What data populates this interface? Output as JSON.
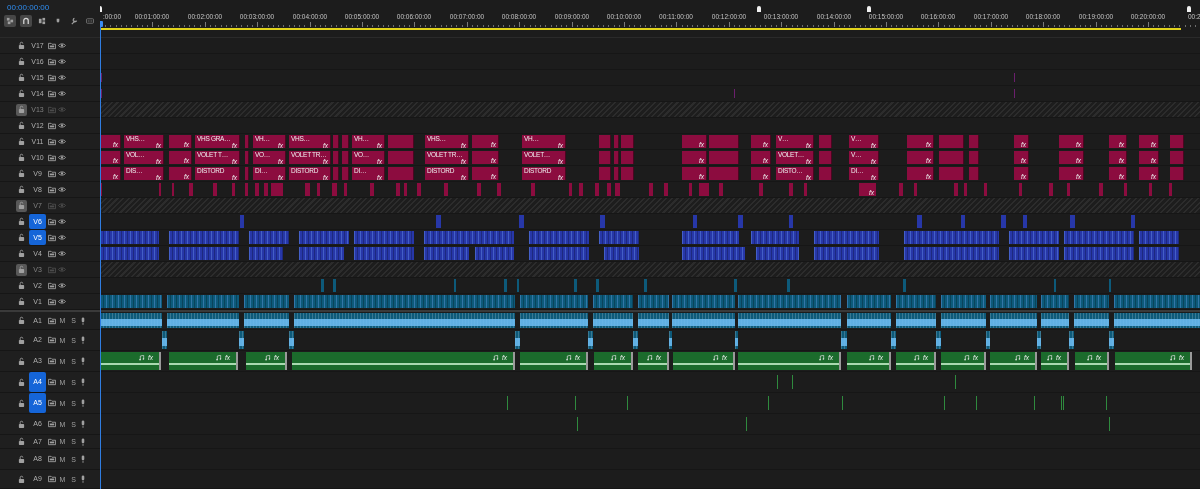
{
  "timecode": "00:00:00:00",
  "toolbar": [
    {
      "kind": "nest",
      "selected": true
    },
    {
      "kind": "snap",
      "selected": true
    },
    {
      "kind": "linked",
      "selected": false
    },
    {
      "kind": "marker",
      "selected": false
    },
    {
      "kind": "wrench",
      "selected": false
    },
    {
      "kind": "captions",
      "selected": false
    }
  ],
  "ruler": {
    "labels": [
      ":00:00",
      "00:01:00:00",
      "00:02:00:00",
      "00:03:00:00",
      "00:04:00:00",
      "00:05:00:00",
      "00:06:00:00",
      "00:07:00:00",
      "00:08:00:00",
      "00:09:00:00",
      "00:10:00:00",
      "00:11:00:00",
      "00:12:00:00",
      "00:13:00:00",
      "00:14:00:00",
      "00:15:00:00",
      "00:16:00:00",
      "00:17:00:00",
      "00:18:00:00",
      "00:19:00:00",
      "00:20:00:00",
      "00:2"
    ]
  },
  "tracks": [
    {
      "name": "V17",
      "kind": "video",
      "locked": false,
      "targeted": false
    },
    {
      "name": "V16",
      "kind": "video",
      "locked": false,
      "targeted": false
    },
    {
      "name": "V15",
      "kind": "video",
      "locked": false,
      "targeted": false,
      "color": "#6b1f6d"
    },
    {
      "name": "V14",
      "kind": "video",
      "locked": false,
      "targeted": false,
      "color": "#6b1f6d"
    },
    {
      "name": "V13",
      "kind": "video",
      "locked": true,
      "targeted": false
    },
    {
      "name": "V12",
      "kind": "video",
      "locked": false,
      "targeted": false
    },
    {
      "name": "V11",
      "kind": "video",
      "locked": false,
      "targeted": false,
      "color": "#8c0c3f",
      "clips": [
        {
          "fx": "fx"
        },
        {
          "label": "VHS…",
          "fx": "fx"
        },
        {
          "fx": "fx"
        },
        {
          "label": "VHS GRA…",
          "fx": "fx"
        },
        {
          "label": "VH…",
          "fx": "fx"
        },
        {
          "label": "VHS…",
          "fx": "fx"
        },
        {
          "label": "VH…",
          "fx": "fx"
        },
        {
          "label": "VHS…",
          "fx": "fx"
        },
        {
          "fx": "fx"
        },
        {
          "label": "VH…",
          "fx": "fx"
        },
        {
          "fx": "fx"
        },
        {
          "fx": "fx"
        },
        {
          "label": "V…",
          "fx": "fx"
        },
        {
          "label": "V…",
          "fx": "fx"
        },
        {
          "fx": "fx"
        },
        {
          "fx": "fx"
        },
        {
          "fx": "fx"
        },
        {
          "fx": "fx"
        },
        {
          "fx": "fx"
        }
      ]
    },
    {
      "name": "V10",
      "kind": "video",
      "locked": false,
      "targeted": false,
      "color": "#8c0c3f",
      "clips": [
        {
          "fx": "fx"
        },
        {
          "label": "VOL…",
          "fx": "fx"
        },
        {
          "fx": "fx"
        },
        {
          "label": "VOLET T…",
          "fx": "fx"
        },
        {
          "label": "VO…",
          "fx": "fx"
        },
        {
          "label": "VOLET TR…",
          "fx": "fx"
        },
        {
          "label": "VO…",
          "fx": "fx"
        },
        {
          "label": "VOLET TR…",
          "fx": "fx"
        },
        {
          "fx": "fx"
        },
        {
          "label": "VOLET…",
          "fx": "fx"
        },
        {
          "fx": "fx"
        },
        {
          "fx": "fx"
        },
        {
          "label": "VOLET…",
          "fx": "fx"
        },
        {
          "label": "V…",
          "fx": "fx"
        },
        {
          "fx": "fx"
        },
        {
          "fx": "fx"
        },
        {
          "fx": "fx"
        },
        {
          "fx": "fx"
        },
        {
          "fx": "fx"
        }
      ]
    },
    {
      "name": "V9",
      "kind": "video",
      "locked": false,
      "targeted": false,
      "color": "#8c0c3f",
      "clips": [
        {
          "fx": "fx"
        },
        {
          "label": "DIS…",
          "fx": "fx"
        },
        {
          "fx": "fx"
        },
        {
          "label": "DISTORD",
          "fx": "fx"
        },
        {
          "label": "DI…",
          "fx": "fx"
        },
        {
          "label": "DISTORD",
          "fx": "fx"
        },
        {
          "label": "DI…",
          "fx": "fx"
        },
        {
          "label": "DISTORD",
          "fx": "fx"
        },
        {
          "fx": "fx"
        },
        {
          "label": "DISTORD",
          "fx": "fx"
        },
        {
          "fx": "fx"
        },
        {
          "fx": "fx"
        },
        {
          "label": "DISTO…",
          "fx": "fx"
        },
        {
          "label": "DI…",
          "fx": "fx"
        },
        {
          "fx": "fx"
        },
        {
          "fx": "fx"
        },
        {
          "fx": "fx"
        },
        {
          "fx": "fx"
        },
        {
          "fx": "fx"
        }
      ]
    },
    {
      "name": "V8",
      "kind": "video",
      "locked": false,
      "targeted": false,
      "color": "#8c0c3f",
      "clips": [
        {
          "fx": "fx"
        }
      ]
    },
    {
      "name": "V7",
      "kind": "video",
      "locked": true,
      "targeted": false
    },
    {
      "name": "V6",
      "kind": "video",
      "locked": false,
      "targeted": true,
      "color": "#2737a8"
    },
    {
      "name": "V5",
      "kind": "video",
      "locked": false,
      "targeted": true,
      "color": "#2737a8"
    },
    {
      "name": "V4",
      "kind": "video",
      "locked": false,
      "targeted": false,
      "color": "#2737a8"
    },
    {
      "name": "V3",
      "kind": "video",
      "locked": true,
      "targeted": false
    },
    {
      "name": "V2",
      "kind": "video",
      "locked": false,
      "targeted": false,
      "color": "#0d5a7a"
    },
    {
      "name": "V1",
      "kind": "video",
      "locked": false,
      "targeted": false,
      "color": "#0d5a7a"
    },
    {
      "name": "A1",
      "kind": "audio",
      "mute": "M",
      "solo": "S",
      "locked": false,
      "targeted": false,
      "color": "#0d5a7a"
    },
    {
      "name": "A2",
      "kind": "audio",
      "mute": "M",
      "solo": "S",
      "locked": false,
      "targeted": false,
      "color": "#0d5a7a"
    },
    {
      "name": "A3",
      "kind": "audio",
      "mute": "M",
      "solo": "S",
      "locked": false,
      "targeted": false,
      "color": "#1b6b2c",
      "clips": [
        {
          "fx": "fx"
        },
        {
          "fx": "fx"
        },
        {
          "fx": "fx"
        },
        {
          "fx": "fx"
        },
        {
          "fx": "fx"
        },
        {
          "fx": "fx"
        },
        {
          "fx": "fx"
        },
        {
          "fx": "fx"
        },
        {
          "fx": "fx"
        },
        {
          "fx": "fx"
        },
        {
          "fx": "fx"
        },
        {
          "fx": "fx"
        },
        {
          "fx": "fx"
        },
        {
          "fx": "fx"
        },
        {
          "fx": "fx"
        },
        {
          "fx": "fx"
        }
      ]
    },
    {
      "name": "A4",
      "kind": "audio",
      "mute": "M",
      "solo": "S",
      "locked": false,
      "targeted": true,
      "color": "#2f8a3e"
    },
    {
      "name": "A5",
      "kind": "audio",
      "mute": "M",
      "solo": "S",
      "locked": false,
      "targeted": true,
      "color": "#2f8a3e"
    },
    {
      "name": "A6",
      "kind": "audio",
      "mute": "M",
      "solo": "S",
      "locked": false,
      "targeted": false,
      "color": "#2f8a3e"
    },
    {
      "name": "A7",
      "kind": "audio",
      "mute": "M",
      "solo": "S",
      "locked": false,
      "targeted": false
    },
    {
      "name": "A8",
      "kind": "audio",
      "mute": "M",
      "solo": "S",
      "locked": false,
      "targeted": false
    },
    {
      "name": "A9",
      "kind": "audio",
      "mute": "M",
      "solo": "S",
      "locked": false,
      "targeted": false
    }
  ]
}
